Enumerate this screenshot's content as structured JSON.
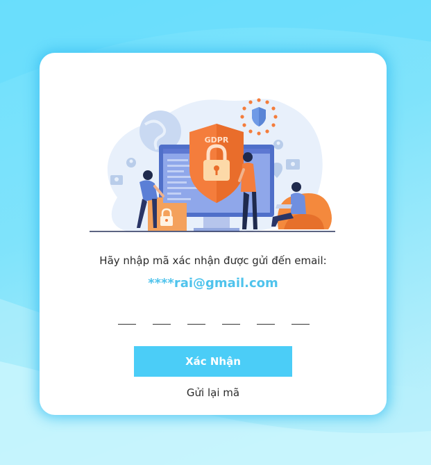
{
  "verification": {
    "prompt": "Hãy nhập mã xác nhận được gửi đến email:",
    "email": "****rai@gmail.com",
    "confirm_label": "Xác Nhận",
    "resend_label": "Gửi lại mã"
  },
  "illustration": {
    "badge_text": "GDPR",
    "icon": "security-illustration"
  },
  "otp": {
    "length": 6,
    "values": [
      "",
      "",
      "",
      "",
      "",
      ""
    ]
  },
  "colors": {
    "accent": "#4bcdf7",
    "email": "#4fc3ec",
    "background": "#6fe0fd"
  }
}
